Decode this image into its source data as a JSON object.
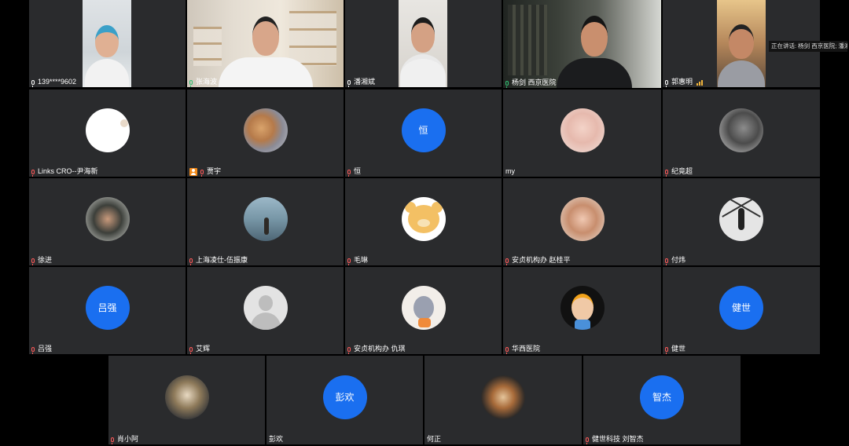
{
  "speaking_tip": "正在讲话: 杨剑 西京医院; 潘湘...",
  "participants": [
    {
      "name": "139****9602"
    },
    {
      "name": "张海波"
    },
    {
      "name": "潘湘斌"
    },
    {
      "name": "杨剑 西京医院"
    },
    {
      "name": "郭惠明"
    },
    {
      "name": "Links CRO--尹海新"
    },
    {
      "name": "贾宇"
    },
    {
      "name": "恒",
      "avatar_text": "恒"
    },
    {
      "name": "my"
    },
    {
      "name": "纪竟超"
    },
    {
      "name": "徐进"
    },
    {
      "name": "上海凌仕-伍振康"
    },
    {
      "name": "毛琳"
    },
    {
      "name": "安贞机构办 赵桂平"
    },
    {
      "name": "付炜"
    },
    {
      "name": "吕强",
      "avatar_text": "吕强"
    },
    {
      "name": "艾辉"
    },
    {
      "name": "安贞机构办 仇琪"
    },
    {
      "name": "华西医院"
    },
    {
      "name": "健世",
      "avatar_text": "健世"
    },
    {
      "name": "肖小阿"
    },
    {
      "name": "彭欢",
      "avatar_text": "彭欢"
    },
    {
      "name": "何正"
    },
    {
      "name": "健世科技 刘智杰",
      "avatar_text": "智杰"
    }
  ],
  "colors": {
    "tile_bg": "#2a2b2d",
    "avatar_blue": "#1a6ff0",
    "active_border": "#2fbf71",
    "signal": "#f1b43b"
  }
}
